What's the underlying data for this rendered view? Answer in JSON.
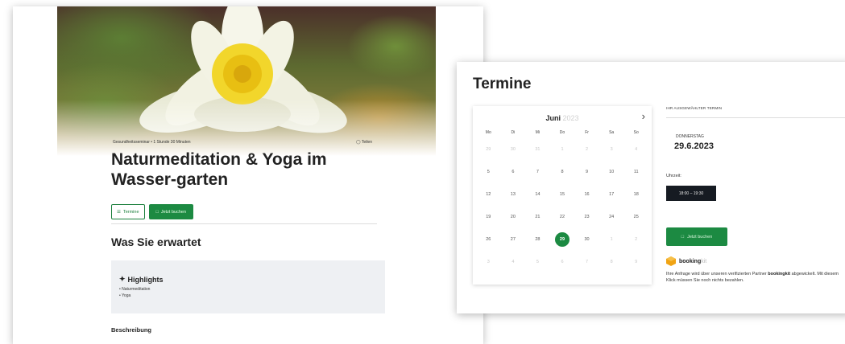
{
  "event": {
    "meta_left": "Gesundheitsseminar • 1 Stunde 30 Minuten",
    "meta_right": "Teilen",
    "title": "Naturmeditation & Yoga im Wasser-garten",
    "btn_termine": "Termine",
    "btn_book": "Jetzt buchen",
    "section_title": "Was Sie erwartet",
    "highlights_title": "Highlights",
    "highlights": [
      "• Naturmeditation",
      "• Yoga"
    ],
    "description_label": "Beschreibung"
  },
  "termine": {
    "title": "Termine",
    "month": "Juni",
    "year": "2023",
    "weekdays": [
      "Mo",
      "Di",
      "Mi",
      "Do",
      "Fr",
      "Sa",
      "So"
    ],
    "weeks": [
      [
        {
          "d": "29",
          "dim": true
        },
        {
          "d": "30",
          "dim": true
        },
        {
          "d": "31",
          "dim": true
        },
        {
          "d": "1",
          "dim": true
        },
        {
          "d": "2",
          "dim": true
        },
        {
          "d": "3",
          "dim": true
        },
        {
          "d": "4",
          "dim": true
        }
      ],
      [
        {
          "d": "5"
        },
        {
          "d": "6"
        },
        {
          "d": "7"
        },
        {
          "d": "8"
        },
        {
          "d": "9"
        },
        {
          "d": "10"
        },
        {
          "d": "11"
        }
      ],
      [
        {
          "d": "12"
        },
        {
          "d": "13"
        },
        {
          "d": "14"
        },
        {
          "d": "15"
        },
        {
          "d": "16"
        },
        {
          "d": "17"
        },
        {
          "d": "18"
        }
      ],
      [
        {
          "d": "19"
        },
        {
          "d": "20"
        },
        {
          "d": "21"
        },
        {
          "d": "22"
        },
        {
          "d": "23"
        },
        {
          "d": "24"
        },
        {
          "d": "25"
        }
      ],
      [
        {
          "d": "26"
        },
        {
          "d": "27"
        },
        {
          "d": "28"
        },
        {
          "d": "29",
          "selected": true
        },
        {
          "d": "30"
        },
        {
          "d": "1",
          "dim": true
        },
        {
          "d": "2",
          "dim": true
        }
      ],
      [
        {
          "d": "3",
          "dim": true
        },
        {
          "d": "4",
          "dim": true
        },
        {
          "d": "5",
          "dim": true
        },
        {
          "d": "6",
          "dim": true
        },
        {
          "d": "7",
          "dim": true
        },
        {
          "d": "8",
          "dim": true
        },
        {
          "d": "9",
          "dim": true
        }
      ]
    ],
    "selected_heading": "IHR AUSGEWÄHLTER TERMIN",
    "selected_weekday": "DONNERSTAG",
    "selected_date": "29.6.2023",
    "time_label": "Uhrzeit:",
    "time_slot": "18:00 – 19:30",
    "book_label": "Jetzt buchen",
    "provider_name": "booking",
    "provider_suffix": "kit",
    "note_1": "Ihre Anfrage wird über unseren verifizierten Partner",
    "note_brand": "bookingkit",
    "note_2": "abgewickelt. Mit diesem Klick müssen Sie noch nichts bezahlen."
  },
  "colors": {
    "accent_green": "#1c8a42",
    "time_chip_bg": "#161b22"
  }
}
